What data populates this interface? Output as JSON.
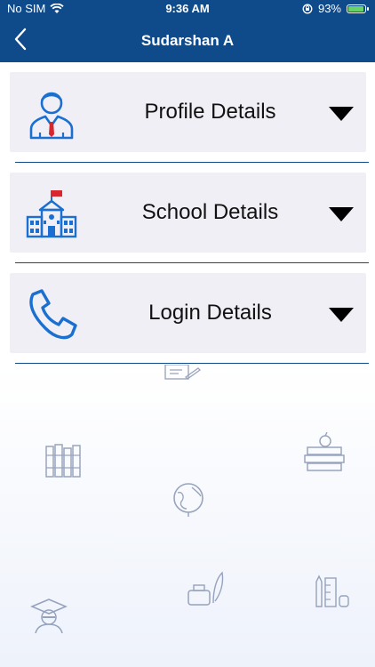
{
  "status": {
    "carrier": "No SIM",
    "time": "9:36 AM",
    "battery_pct": "93%"
  },
  "nav": {
    "title": "Sudarshan A"
  },
  "sections": [
    {
      "label": "Profile Details",
      "icon": "person-icon"
    },
    {
      "label": "School Details",
      "icon": "school-icon"
    },
    {
      "label": "Login Details",
      "icon": "phone-icon"
    }
  ],
  "colors": {
    "header": "#0f4a8a",
    "card": "#efeff5",
    "accent_blue": "#1a6fd1"
  }
}
